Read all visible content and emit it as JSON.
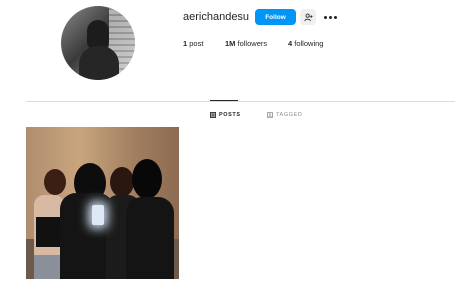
{
  "profile": {
    "username": "aerichandesu",
    "follow_label": "Follow"
  },
  "stats": {
    "posts_count": "1",
    "posts_label": "post",
    "followers_count": "1M",
    "followers_label": "followers",
    "following_count": "4",
    "following_label": "following"
  },
  "tabs": {
    "posts_label": "POSTS",
    "tagged_label": "TAGGED"
  },
  "colors": {
    "follow_button": "#0095f6",
    "divider": "#dbdbdb"
  },
  "icons": {
    "suggest": "add-person-icon",
    "more": "more-options-icon",
    "posts_tab": "grid-icon",
    "tagged_tab": "tag-icon"
  }
}
